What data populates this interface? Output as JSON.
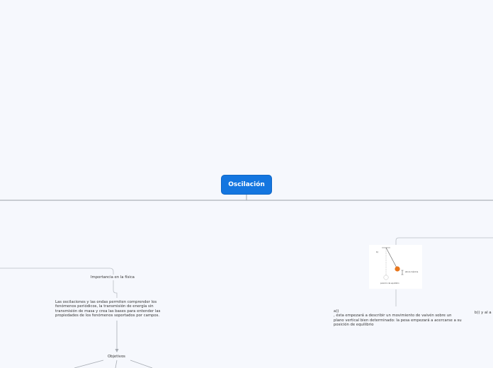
{
  "root": {
    "title": "Oscilación"
  },
  "nodes": {
    "importance": "Importancia  en la física",
    "importance_text": "Las oscilaciones y las ondas permiten comprender los fenómenos periódicos, la transmisión de energía sin transmisión de masa y crea las bases para entender las propiedades de los fenómenos soportados por campos.",
    "objetivos": "Objetivos",
    "a_text": "a))\n, ésta empezará a describir un movimiento de vaivén sobre un plano vertical bien determinado: la pesa empezará a acercarse a su posición de equilibrio",
    "b_text": "b)) y al a"
  },
  "pendulum": {
    "label_top": "b)",
    "label_right": "altura máxima",
    "label_bottom": "posición de equilibrio",
    "bob_color": "#e8761c"
  },
  "colors": {
    "background": "#f6f8fd",
    "root_fill": "#1476e0",
    "connector": "#a7acb3"
  }
}
